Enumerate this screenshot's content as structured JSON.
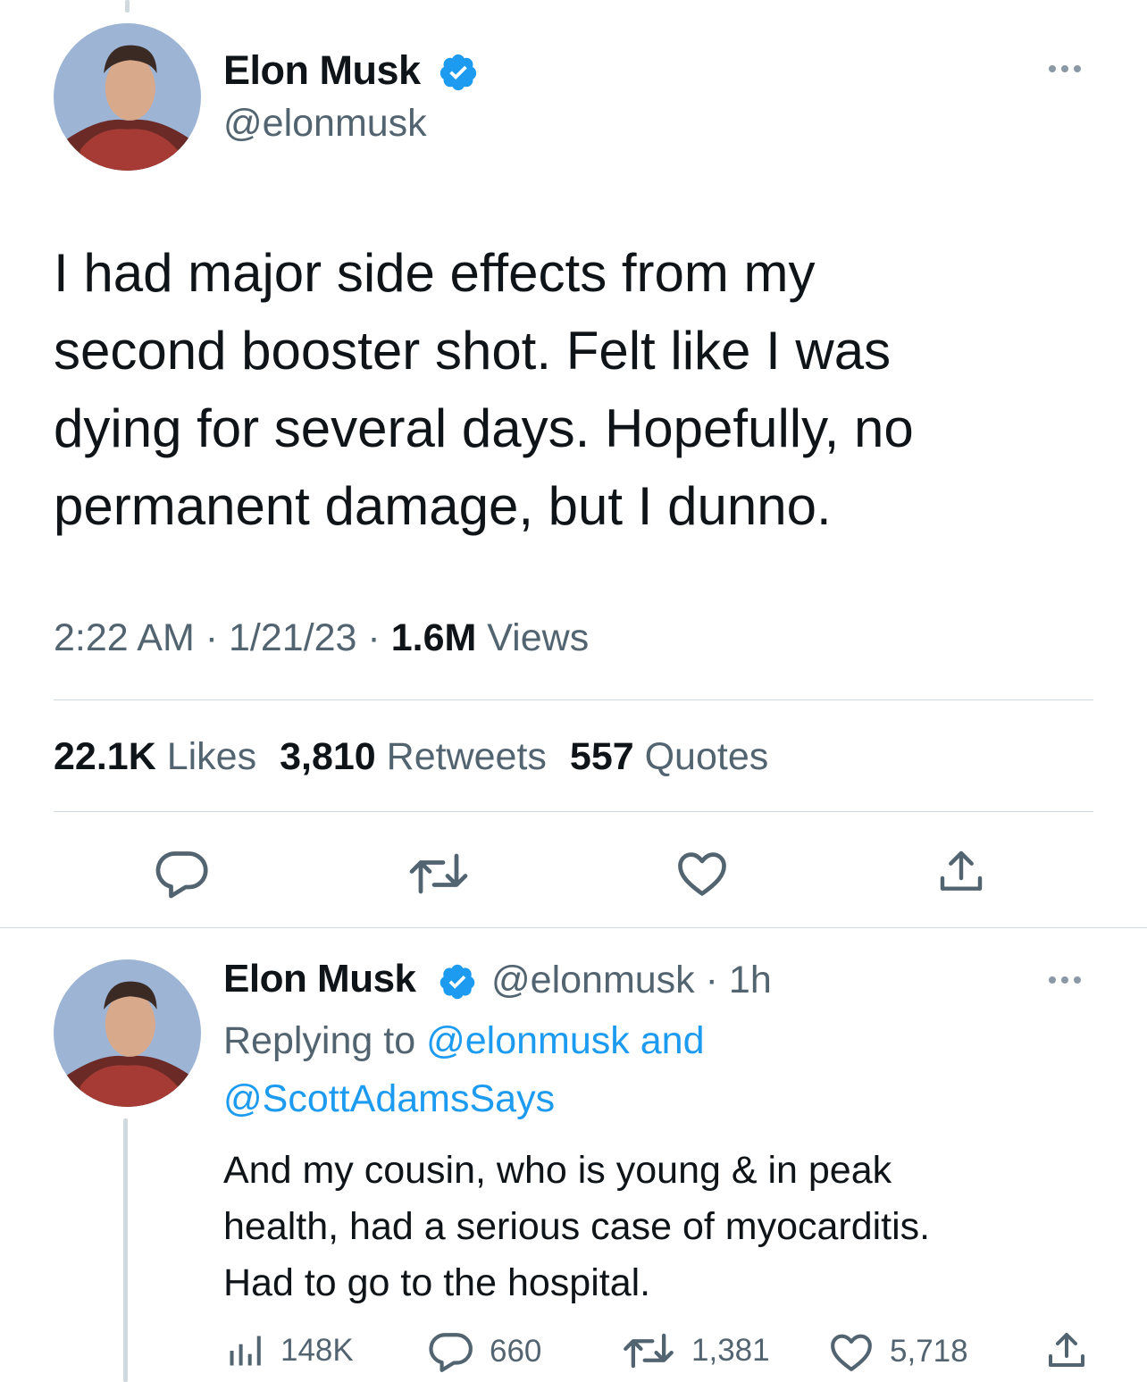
{
  "main_tweet": {
    "author_name": "Elon Musk",
    "author_handle": "@elonmusk",
    "text_lines": [
      "I had major side effects from my",
      "second booster shot. Felt like I was",
      "dying for several days. Hopefully, no",
      "permanent damage, but I dunno."
    ],
    "time": "2:22 AM",
    "date": "1/21/23",
    "views_count": "1.6M",
    "views_label": "Views",
    "separator": "·",
    "likes_count": "22.1K",
    "likes_label": "Likes",
    "retweets_count": "3,810",
    "retweets_label": "Retweets",
    "quotes_count": "557",
    "quotes_label": "Quotes"
  },
  "reply_tweet": {
    "author_name": "Elon Musk",
    "author_handle": "@elonmusk",
    "time_ago": "· 1h",
    "replying_prefix": "Replying to",
    "replying_user_1": "@elonmusk",
    "replying_and": "and",
    "replying_user_2": "@ScottAdamsSays",
    "text_lines": [
      "And my cousin, who is young & in peak",
      "health, had a serious case of myocarditis.",
      "Had to go to the hospital."
    ],
    "views": "148K",
    "replies": "660",
    "retweets": "1,381",
    "likes": "5,718"
  },
  "colors": {
    "verified_badge": "#1d9bf0",
    "link": "#1d9bf0",
    "secondary_text": "#536471",
    "primary_text": "#0f1419",
    "icon": "#536471",
    "divider": "#cfd9de"
  },
  "icons": [
    "verified-badge-icon",
    "more-options-icon",
    "reply-icon",
    "retweet-icon",
    "like-icon",
    "share-icon",
    "views-icon"
  ]
}
